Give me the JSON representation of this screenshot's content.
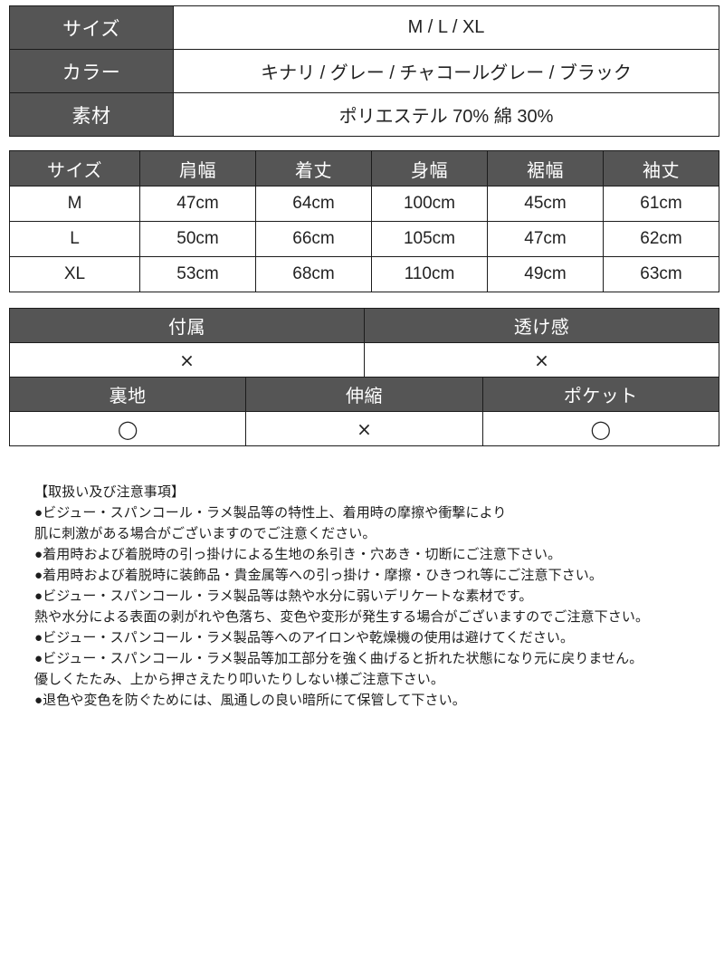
{
  "basic_spec": {
    "rows": [
      {
        "label": "サイズ",
        "value": "M / L / XL"
      },
      {
        "label": "カラー",
        "value": "キナリ / グレー / チャコールグレー / ブラック"
      },
      {
        "label": "素材",
        "value": "ポリエステル 70%  綿 30%"
      }
    ]
  },
  "measurements": {
    "headers": [
      "サイズ",
      "肩幅",
      "着丈",
      "身幅",
      "裾幅",
      "袖丈"
    ],
    "rows": [
      [
        "M",
        "47cm",
        "64cm",
        "100cm",
        "45cm",
        "61cm"
      ],
      [
        "L",
        "50cm",
        "66cm",
        "105cm",
        "47cm",
        "62cm"
      ],
      [
        "XL",
        "53cm",
        "68cm",
        "110cm",
        "49cm",
        "63cm"
      ]
    ]
  },
  "features": {
    "row1_headers": [
      "付属",
      "透け感"
    ],
    "row1_values": [
      "×",
      "×"
    ],
    "row2_headers": [
      "裏地",
      "伸縮",
      "ポケット"
    ],
    "row2_values": [
      "◯",
      "×",
      "◯"
    ]
  },
  "care_notes": {
    "heading": "【取扱い及び注意事項】",
    "lines": [
      "●ビジュー・スパンコール・ラメ製品等の特性上、着用時の摩擦や衝撃により",
      "肌に刺激がある場合がございますのでご注意ください。",
      "●着用時および着脱時の引っ掛けによる生地の糸引き・穴あき・切断にご注意下さい。",
      "●着用時および着脱時に装飾品・貴金属等への引っ掛け・摩擦・ひきつれ等にご注意下さい。",
      "●ビジュー・スパンコール・ラメ製品等は熱や水分に弱いデリケートな素材です。",
      "熱や水分による表面の剥がれや色落ち、変色や変形が発生する場合がございますのでご注意下さい。",
      "●ビジュー・スパンコール・ラメ製品等へのアイロンや乾燥機の使用は避けてください。",
      "●ビジュー・スパンコール・ラメ製品等加工部分を強く曲げると折れた状態になり元に戻りません。",
      "優しくたたみ、上から押さえたり叩いたりしない様ご注意下さい。",
      "●退色や変色を防ぐためには、風通しの良い暗所にて保管して下さい。"
    ]
  },
  "colors": {
    "header_bg": "#555555",
    "header_text": "#ffffff",
    "cell_bg": "#ffffff",
    "cell_text": "#222222",
    "border": "#1c1c1c",
    "page_bg": "#ffffff"
  }
}
